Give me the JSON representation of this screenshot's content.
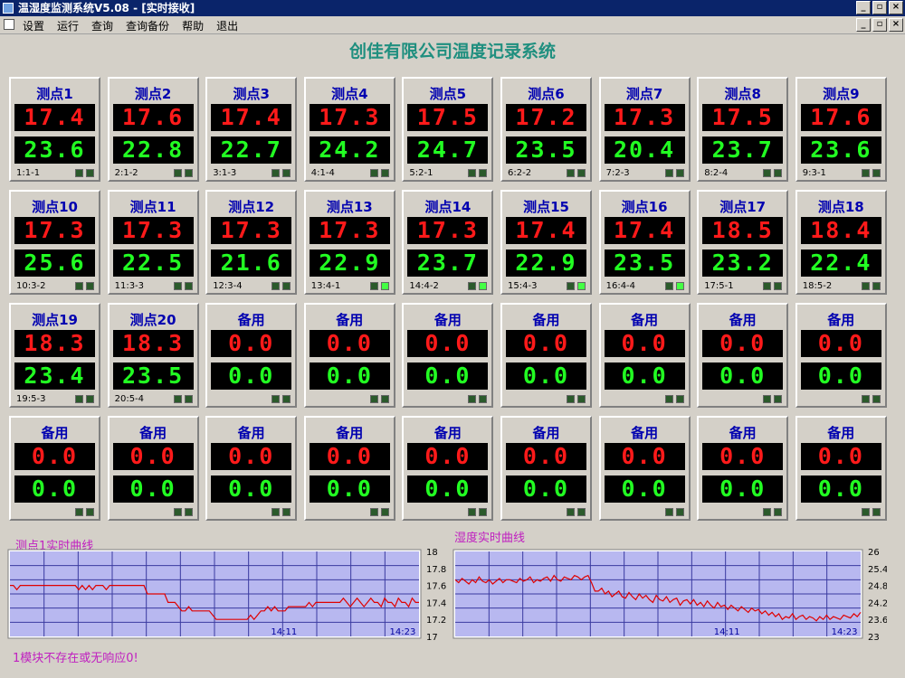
{
  "window": {
    "title": "温湿度监测系统V5.08 - [实时接收]"
  },
  "menu": {
    "items": [
      "设置",
      "运行",
      "查询",
      "查询备份",
      "帮助",
      "退出"
    ]
  },
  "app_title": "创佳有限公司温度记录系统",
  "window_buttons": {
    "minimize": "_",
    "restore": "▫",
    "close": "×"
  },
  "sensors": [
    {
      "name": "测点1",
      "temp": "17.4",
      "hum": "23.6",
      "addr": "1:1-1",
      "led": false
    },
    {
      "name": "测点2",
      "temp": "17.6",
      "hum": "22.8",
      "addr": "2:1-2",
      "led": false
    },
    {
      "name": "测点3",
      "temp": "17.4",
      "hum": "22.7",
      "addr": "3:1-3",
      "led": false
    },
    {
      "name": "测点4",
      "temp": "17.3",
      "hum": "24.2",
      "addr": "4:1-4",
      "led": false
    },
    {
      "name": "测点5",
      "temp": "17.5",
      "hum": "24.7",
      "addr": "5:2-1",
      "led": false
    },
    {
      "name": "测点6",
      "temp": "17.2",
      "hum": "23.5",
      "addr": "6:2-2",
      "led": false
    },
    {
      "name": "测点7",
      "temp": "17.3",
      "hum": "20.4",
      "addr": "7:2-3",
      "led": false
    },
    {
      "name": "测点8",
      "temp": "17.5",
      "hum": "23.7",
      "addr": "8:2-4",
      "led": false
    },
    {
      "name": "测点9",
      "temp": "17.6",
      "hum": "23.6",
      "addr": "9:3-1",
      "led": false
    },
    {
      "name": "测点10",
      "temp": "17.3",
      "hum": "25.6",
      "addr": "10:3-2",
      "led": false
    },
    {
      "name": "测点11",
      "temp": "17.3",
      "hum": "22.5",
      "addr": "11:3-3",
      "led": false
    },
    {
      "name": "测点12",
      "temp": "17.3",
      "hum": "21.6",
      "addr": "12:3-4",
      "led": false
    },
    {
      "name": "测点13",
      "temp": "17.3",
      "hum": "22.9",
      "addr": "13:4-1",
      "led": true
    },
    {
      "name": "测点14",
      "temp": "17.3",
      "hum": "23.7",
      "addr": "14:4-2",
      "led": true
    },
    {
      "name": "测点15",
      "temp": "17.4",
      "hum": "22.9",
      "addr": "15:4-3",
      "led": true
    },
    {
      "name": "测点16",
      "temp": "17.4",
      "hum": "23.5",
      "addr": "16:4-4",
      "led": true
    },
    {
      "name": "测点17",
      "temp": "18.5",
      "hum": "23.2",
      "addr": "17:5-1",
      "led": false
    },
    {
      "name": "测点18",
      "temp": "18.4",
      "hum": "22.4",
      "addr": "18:5-2",
      "led": false
    },
    {
      "name": "测点19",
      "temp": "18.3",
      "hum": "23.4",
      "addr": "19:5-3",
      "led": false
    },
    {
      "name": "测点20",
      "temp": "18.3",
      "hum": "23.5",
      "addr": "20:5-4",
      "led": false
    },
    {
      "name": "备用",
      "temp": "0.0",
      "hum": "0.0",
      "addr": "",
      "led": false
    },
    {
      "name": "备用",
      "temp": "0.0",
      "hum": "0.0",
      "addr": "",
      "led": false
    },
    {
      "name": "备用",
      "temp": "0.0",
      "hum": "0.0",
      "addr": "",
      "led": false
    },
    {
      "name": "备用",
      "temp": "0.0",
      "hum": "0.0",
      "addr": "",
      "led": false
    },
    {
      "name": "备用",
      "temp": "0.0",
      "hum": "0.0",
      "addr": "",
      "led": false
    },
    {
      "name": "备用",
      "temp": "0.0",
      "hum": "0.0",
      "addr": "",
      "led": false
    },
    {
      "name": "备用",
      "temp": "0.0",
      "hum": "0.0",
      "addr": "",
      "led": false
    },
    {
      "name": "备用",
      "temp": "0.0",
      "hum": "0.0",
      "addr": "",
      "led": false
    },
    {
      "name": "备用",
      "temp": "0.0",
      "hum": "0.0",
      "addr": "",
      "led": false
    },
    {
      "name": "备用",
      "temp": "0.0",
      "hum": "0.0",
      "addr": "",
      "led": false
    },
    {
      "name": "备用",
      "temp": "0.0",
      "hum": "0.0",
      "addr": "",
      "led": false
    },
    {
      "name": "备用",
      "temp": "0.0",
      "hum": "0.0",
      "addr": "",
      "led": false
    },
    {
      "name": "备用",
      "temp": "0.0",
      "hum": "0.0",
      "addr": "",
      "led": false
    },
    {
      "name": "备用",
      "temp": "0.0",
      "hum": "0.0",
      "addr": "",
      "led": false
    },
    {
      "name": "备用",
      "temp": "0.0",
      "hum": "0.0",
      "addr": "",
      "led": false
    },
    {
      "name": "备用",
      "temp": "0.0",
      "hum": "0.0",
      "addr": "",
      "led": false
    }
  ],
  "colors": {
    "temp": "#ff1a1a",
    "hum": "#22ff22",
    "chart_bg": "#b8b8f0",
    "chart_grid": "#3a3aa0",
    "chart_line": "#e00000",
    "title": "#1f8f7f"
  },
  "status": "1模块不存在或无响应0!",
  "chart_data": [
    {
      "type": "line",
      "title": "测点1实时曲线",
      "ylim": [
        17,
        18
      ],
      "yticks": [
        "18",
        "17.8",
        "17.6",
        "17.4",
        "17.2",
        "17"
      ],
      "xticks": [
        "14:11",
        "14:23"
      ],
      "grid": true,
      "series": [
        {
          "values": [
            17.6,
            17.6,
            17.55,
            17.6,
            17.6,
            17.6,
            17.6,
            17.6,
            17.6,
            17.6,
            17.6,
            17.6,
            17.6,
            17.6,
            17.6,
            17.6,
            17.6,
            17.6,
            17.6,
            17.6,
            17.55,
            17.6,
            17.55,
            17.6,
            17.55,
            17.6,
            17.6,
            17.6,
            17.55,
            17.6,
            17.6,
            17.6,
            17.6,
            17.6,
            17.6,
            17.6,
            17.6,
            17.6,
            17.6,
            17.6,
            17.5,
            17.5,
            17.5,
            17.5,
            17.5,
            17.5,
            17.4,
            17.4,
            17.4,
            17.35,
            17.3,
            17.3,
            17.35,
            17.3,
            17.3,
            17.3,
            17.3,
            17.3,
            17.3,
            17.25,
            17.2,
            17.2,
            17.2,
            17.2,
            17.2,
            17.2,
            17.2,
            17.2,
            17.2,
            17.2,
            17.25,
            17.2,
            17.25,
            17.3,
            17.3,
            17.35,
            17.3,
            17.35,
            17.3,
            17.3,
            17.3,
            17.35,
            17.35,
            17.35,
            17.35,
            17.35,
            17.35,
            17.4,
            17.35,
            17.4,
            17.4,
            17.4,
            17.4,
            17.4,
            17.4,
            17.4,
            17.4,
            17.45,
            17.4,
            17.35,
            17.4,
            17.45,
            17.4,
            17.35,
            17.4,
            17.45,
            17.4,
            17.4,
            17.35,
            17.45,
            17.4,
            17.4,
            17.35,
            17.45,
            17.4,
            17.4,
            17.35,
            17.45,
            17.4,
            17.4
          ]
        }
      ]
    },
    {
      "type": "line",
      "title": "湿度实时曲线",
      "ylim": [
        23,
        26
      ],
      "yticks": [
        "26",
        "25.4",
        "24.8",
        "24.2",
        "23.6",
        "23"
      ],
      "xticks": [
        "14:11",
        "14:23"
      ],
      "grid": true,
      "series": [
        {
          "values": [
            25.0,
            24.9,
            25.05,
            24.95,
            24.85,
            25.0,
            24.9,
            25.1,
            24.95,
            24.9,
            25.0,
            24.85,
            24.95,
            25.05,
            24.9,
            25.0,
            25.0,
            24.95,
            24.9,
            25.05,
            24.95,
            25.0,
            25.1,
            24.9,
            25.0,
            24.95,
            25.05,
            25.1,
            24.95,
            25.15,
            25.0,
            24.95,
            25.1,
            25.05,
            25.0,
            25.15,
            25.1,
            25.0,
            25.1,
            25.15,
            24.9,
            24.6,
            24.6,
            24.7,
            24.5,
            24.6,
            24.4,
            24.5,
            24.6,
            24.4,
            24.35,
            24.55,
            24.4,
            24.3,
            24.5,
            24.35,
            24.45,
            24.3,
            24.2,
            24.45,
            24.3,
            24.25,
            24.4,
            24.2,
            24.3,
            24.35,
            24.1,
            24.25,
            24.3,
            24.15,
            24.3,
            24.1,
            24.2,
            24.05,
            24.25,
            24.1,
            24.0,
            24.2,
            24.05,
            24.1,
            23.95,
            24.1,
            24.0,
            23.9,
            24.05,
            23.95,
            23.85,
            24.0,
            23.9,
            23.95,
            23.8,
            23.9,
            23.75,
            23.85,
            23.7,
            23.8,
            23.6,
            23.7,
            23.65,
            23.8,
            23.6,
            23.7,
            23.75,
            23.6,
            23.7,
            23.65,
            23.55,
            23.7,
            23.6,
            23.75,
            23.6,
            23.7,
            23.65,
            23.6,
            23.75,
            23.7,
            23.65,
            23.8,
            23.7,
            23.85
          ]
        }
      ]
    }
  ]
}
